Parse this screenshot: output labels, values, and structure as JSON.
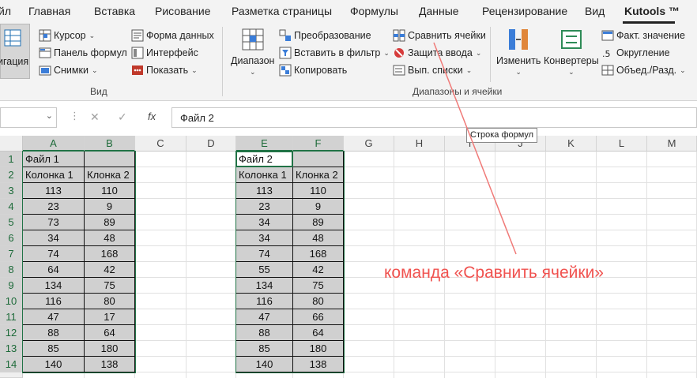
{
  "ribbon_tabs": [
    "йл",
    "Главная",
    "Вставка",
    "Рисование",
    "Разметка страницы",
    "Формулы",
    "Данные",
    "Рецензирование",
    "Вид",
    "Kutools ™"
  ],
  "ribbon": {
    "nav_label": "игация",
    "view_group": {
      "cursor": "Курсор",
      "formula_panel": "Панель формул",
      "snapshots": "Снимки",
      "data_form": "Форма данных",
      "interface": "Интерфейс",
      "show": "Показать",
      "label": "Вид"
    },
    "ranges_group": {
      "range_btn": "Диапазон",
      "transform": "Преобразование",
      "paste_to_filter": "Вставить в фильтр",
      "copy": "Копировать",
      "compare_cells": "Сравнить ячейки",
      "input_protection": "Защита ввода",
      "dropdown_lists": "Вып. списки",
      "change_btn": "Изменить",
      "converters_btn": "Конвертеры",
      "actual_value": "Факт. значение",
      "rounding": "Округление",
      "merge_split": "Объед./Разд.",
      "label": "Диапазоны и ячейки"
    }
  },
  "formula_bar": {
    "cancel_icon": "✕",
    "enter_icon": "✓",
    "fx": "fx",
    "value": "Файл 2"
  },
  "tooltip": "Строка формул",
  "columns": [
    "A",
    "B",
    "C",
    "D",
    "E",
    "F",
    "G",
    "H",
    "I",
    "J",
    "K",
    "L",
    "M"
  ],
  "rows": [
    "1",
    "2",
    "3",
    "4",
    "5",
    "6",
    "7",
    "8",
    "9",
    "10",
    "11",
    "12",
    "13",
    "14"
  ],
  "table1": {
    "title": "Файл 1",
    "headers": [
      "Колонка 1",
      "Клонка 2"
    ],
    "values": [
      [
        113,
        110
      ],
      [
        23,
        9
      ],
      [
        73,
        89
      ],
      [
        34,
        48
      ],
      [
        74,
        168
      ],
      [
        64,
        42
      ],
      [
        134,
        75
      ],
      [
        116,
        80
      ],
      [
        47,
        17
      ],
      [
        88,
        64
      ],
      [
        85,
        180
      ],
      [
        140,
        138
      ]
    ]
  },
  "table2": {
    "title": "Файл 2",
    "headers": [
      "Колонка 1",
      "Клонка 2"
    ],
    "values": [
      [
        113,
        110
      ],
      [
        23,
        9
      ],
      [
        34,
        89
      ],
      [
        34,
        48
      ],
      [
        74,
        168
      ],
      [
        55,
        42
      ],
      [
        134,
        75
      ],
      [
        116,
        80
      ],
      [
        47,
        66
      ],
      [
        88,
        64
      ],
      [
        85,
        180
      ],
      [
        140,
        138
      ]
    ]
  },
  "annotation": "команда «Сравнить ячейки»",
  "colors": {
    "annotation": "#f0524f",
    "excel_green": "#217346",
    "cell_gray": "#d0d0d0"
  }
}
